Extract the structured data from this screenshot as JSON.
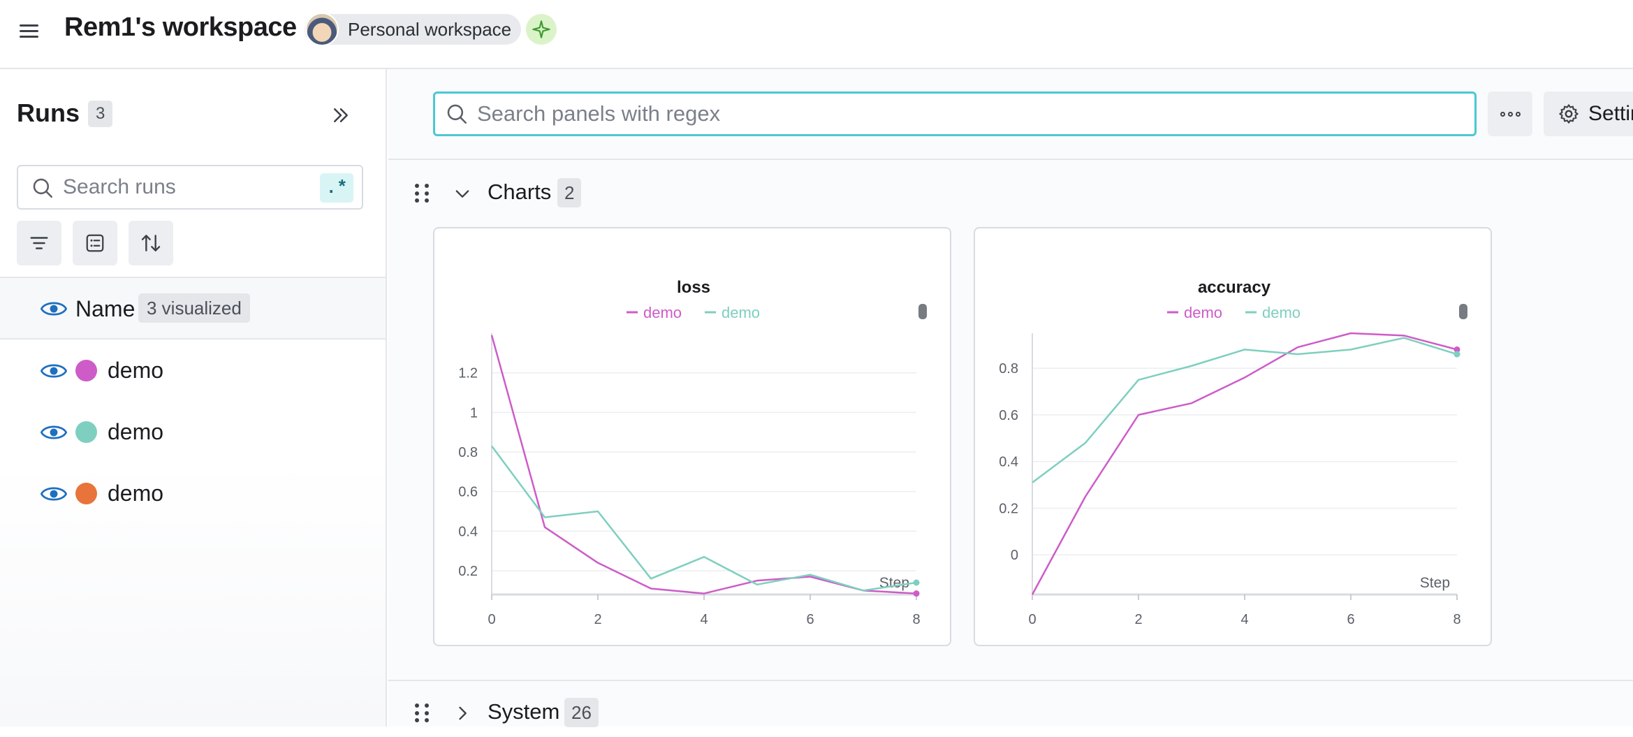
{
  "header": {
    "workspace_title": "Rem1's workspace",
    "workspace_chip": "Personal workspace",
    "menu_icon": "hamburger-icon",
    "assistant_icon": "sparkle-icon"
  },
  "sidebar": {
    "title": "Runs",
    "run_count": "3",
    "search_placeholder": "Search runs",
    "regex_label": ".*",
    "name_column": "Name",
    "visualized_badge": "3 visualized",
    "runs": [
      {
        "name": "demo",
        "color": "#cd5cc8"
      },
      {
        "name": "demo",
        "color": "#7ecfbf"
      },
      {
        "name": "demo",
        "color": "#e8743b"
      }
    ]
  },
  "main": {
    "panel_search_placeholder": "Search panels with regex",
    "settings_label": "Settings",
    "sections": [
      {
        "title": "Charts",
        "count": "2",
        "expanded": true
      },
      {
        "title": "System",
        "count": "26",
        "expanded": false
      }
    ]
  },
  "chart_data": [
    {
      "type": "line",
      "title": "loss",
      "xlabel": "Step",
      "ylabel": "",
      "xlim": [
        0,
        8
      ],
      "ylim": [
        0.08,
        1.4
      ],
      "x_ticks": [
        "0",
        "2",
        "4",
        "6",
        "8"
      ],
      "y_ticks": [
        "0.2",
        "0.4",
        "0.6",
        "0.8",
        "1",
        "1.2"
      ],
      "y_tick_values": [
        0.2,
        0.4,
        0.6,
        0.8,
        1.0,
        1.2
      ],
      "legend": "top-center",
      "grid": true,
      "series": [
        {
          "name": "demo",
          "color": "#cd5cc8",
          "x": [
            0,
            1,
            2,
            3,
            4,
            5,
            6,
            7,
            8
          ],
          "values": [
            1.39,
            0.42,
            0.24,
            0.11,
            0.085,
            0.15,
            0.17,
            0.1,
            0.085
          ]
        },
        {
          "name": "demo",
          "color": "#7ecfbf",
          "x": [
            0,
            1,
            2,
            3,
            4,
            5,
            6,
            7,
            8
          ],
          "values": [
            0.83,
            0.47,
            0.5,
            0.16,
            0.27,
            0.13,
            0.18,
            0.1,
            0.14
          ]
        }
      ]
    },
    {
      "type": "line",
      "title": "accuracy",
      "xlabel": "Step",
      "ylabel": "",
      "xlim": [
        0,
        8
      ],
      "ylim": [
        -0.17,
        0.95
      ],
      "x_ticks": [
        "0",
        "2",
        "4",
        "6",
        "8"
      ],
      "y_ticks": [
        "0",
        "0.2",
        "0.4",
        "0.6",
        "0.8"
      ],
      "y_tick_values": [
        0,
        0.2,
        0.4,
        0.6,
        0.8
      ],
      "legend": "top-center",
      "grid": true,
      "series": [
        {
          "name": "demo",
          "color": "#cd5cc8",
          "x": [
            0,
            1,
            2,
            3,
            4,
            5,
            6,
            7,
            8
          ],
          "values": [
            -0.17,
            0.25,
            0.6,
            0.65,
            0.76,
            0.89,
            0.95,
            0.94,
            0.88
          ]
        },
        {
          "name": "demo",
          "color": "#7ecfbf",
          "x": [
            0,
            1,
            2,
            3,
            4,
            5,
            6,
            7,
            8
          ],
          "values": [
            0.31,
            0.48,
            0.75,
            0.81,
            0.88,
            0.86,
            0.88,
            0.93,
            0.86
          ]
        }
      ]
    }
  ]
}
